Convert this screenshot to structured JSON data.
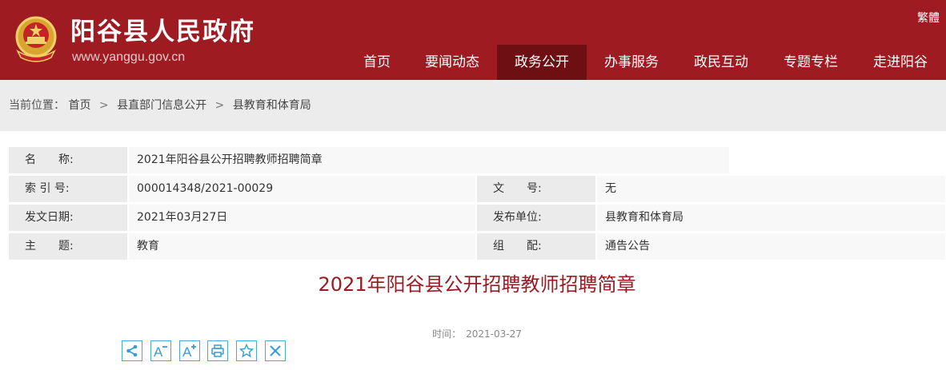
{
  "header": {
    "site_name": "阳谷县人民政府",
    "site_url": "www.yanggu.gov.cn",
    "lang_toggle": "繁體",
    "brand_color": "#9e1b22",
    "active_color": "#6d0f13",
    "emblem_icon": "national-emblem-icon"
  },
  "nav": {
    "items": [
      {
        "label": "首页"
      },
      {
        "label": "要闻动态"
      },
      {
        "label": "政务公开",
        "active": true
      },
      {
        "label": "办事服务"
      },
      {
        "label": "政民互动"
      },
      {
        "label": "专题专栏"
      },
      {
        "label": "走进阳谷"
      }
    ]
  },
  "breadcrumb": {
    "prefix": "当前位置：",
    "items": [
      "首页",
      "县直部门信息公开",
      "县教育和体育局"
    ],
    "separator": ">"
  },
  "info": {
    "name_label": "名　　称:",
    "name_value": "2021年阳谷县公开招聘教师招聘简章",
    "index_label": "索 引 号:",
    "index_value": "000014348/2021-00029",
    "docno_label": "文　　号:",
    "docno_value": "无",
    "date_label": "发文日期:",
    "date_value": "2021年03月27日",
    "publisher_label": "发布单位:",
    "publisher_value": "县教育和体育局",
    "topic_label": "主　　题:",
    "topic_value": "教育",
    "category_label": "组　　配:",
    "category_value": "通告公告"
  },
  "article": {
    "title": "2021年阳谷县公开招聘教师招聘简章",
    "time_label": "时间：",
    "time_value": "2021-03-27",
    "title_color": "#9b1b22"
  },
  "toolbar": {
    "accent_color": "#3a9bd5",
    "icons": [
      "share-icon",
      "font-decrease-icon",
      "font-increase-icon",
      "print-icon",
      "favorite-icon",
      "close-icon"
    ]
  }
}
